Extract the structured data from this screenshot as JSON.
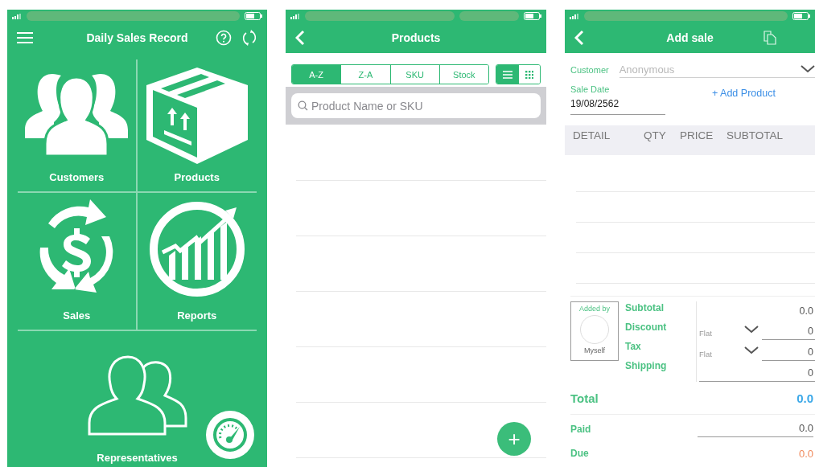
{
  "home": {
    "title": "Daily Sales Record",
    "tiles": [
      {
        "kind": "people",
        "label": "Customers"
      },
      {
        "kind": "box",
        "label": "Products"
      },
      {
        "kind": "money",
        "label": "Sales"
      },
      {
        "kind": "chart",
        "label": "Reports"
      }
    ],
    "wide_tile": {
      "label": "Representatives"
    }
  },
  "products": {
    "title": "Products",
    "sort_tabs": [
      {
        "label": "A-Z",
        "selected": true
      },
      {
        "label": "Z-A",
        "selected": false
      },
      {
        "label": "SKU",
        "selected": false
      },
      {
        "label": "Stock",
        "selected": false
      }
    ],
    "view_toggle": [
      {
        "kind": "list",
        "selected": true
      },
      {
        "kind": "grid",
        "selected": false
      }
    ],
    "search": {
      "placeholder": "Product Name or SKU"
    },
    "add_button": "+"
  },
  "add_sale": {
    "title": "Add sale",
    "customer": {
      "label": "Customer",
      "placeholder": "Anonymous"
    },
    "sale_date": {
      "label": "Sale Date",
      "value": "19/08/2562"
    },
    "add_product": "+ Add Product",
    "columns": [
      "DETAIL",
      "QTY",
      "PRICE",
      "SUBTOTAL"
    ],
    "added_by": {
      "label": "Added by",
      "name": "Myself"
    },
    "summary": [
      {
        "kind": "plain",
        "label": "Subtotal",
        "value": "0.0"
      },
      {
        "kind": "select",
        "label": "Discount",
        "mode": "Flat",
        "value": "0"
      },
      {
        "kind": "select",
        "label": "Tax",
        "mode": "Flat",
        "value": "0"
      },
      {
        "kind": "input",
        "label": "Shipping",
        "value": "0"
      }
    ],
    "total": {
      "label": "Total",
      "value": "0.0"
    },
    "paid": {
      "label": "Paid",
      "value": "0.0"
    },
    "due": {
      "label": "Due",
      "value": "0.0"
    }
  }
}
